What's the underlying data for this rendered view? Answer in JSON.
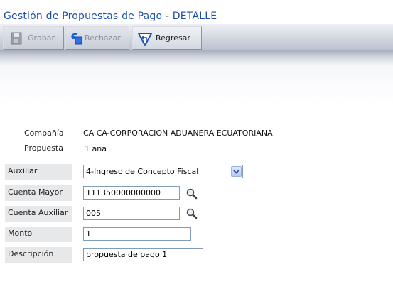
{
  "page": {
    "title": "Gestión de Propuestas de Pago - DETALLE"
  },
  "toolbar": {
    "grabar_label": "Grabar",
    "rechazar_label": "Rechazar",
    "regresar_label": "Regresar"
  },
  "info": {
    "compania_label": "Compañía",
    "compania_value": "CA CA-CORPORACION ADUANERA ECUATORIANA",
    "propuesta_label": "Propuesta",
    "propuesta_value": "1 ana"
  },
  "form": {
    "auxiliar_label": "Auxiliar",
    "auxiliar_value": "4-Ingreso de Concepto Fiscal",
    "cuenta_mayor_label": "Cuenta Mayor",
    "cuenta_mayor_value": "111350000000000",
    "cuenta_auxiliar_label": "Cuenta Auxiliar",
    "cuenta_auxiliar_value": "005",
    "monto_label": "Monto",
    "monto_value": "1",
    "descripcion_label": "Descripción",
    "descripcion_value": "propuesta de pago 1"
  },
  "icons": {
    "grabar": "save-icon",
    "rechazar": "reject-icon",
    "regresar": "return-icon",
    "lookup": "search-icon"
  }
}
